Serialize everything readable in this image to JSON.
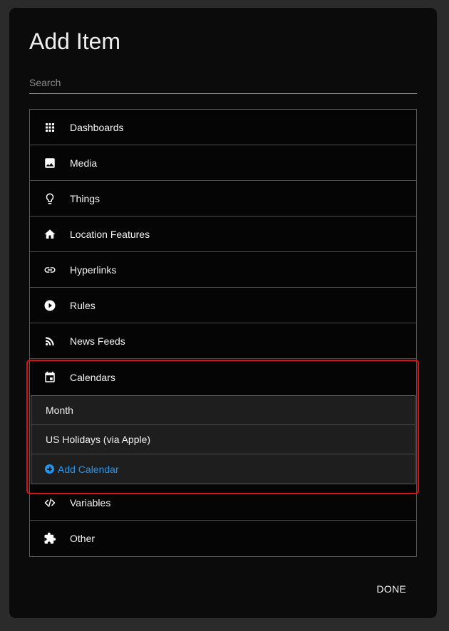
{
  "dialog": {
    "title": "Add Item",
    "search_placeholder": "Search",
    "done_label": "DONE"
  },
  "items": [
    {
      "label": "Dashboards",
      "icon": "grid-icon"
    },
    {
      "label": "Media",
      "icon": "image-icon"
    },
    {
      "label": "Things",
      "icon": "lightbulb-icon"
    },
    {
      "label": "Location Features",
      "icon": "home-icon"
    },
    {
      "label": "Hyperlinks",
      "icon": "link-icon"
    },
    {
      "label": "Rules",
      "icon": "play-circle-icon"
    },
    {
      "label": "News Feeds",
      "icon": "rss-icon"
    },
    {
      "label": "Calendars",
      "icon": "calendar-icon"
    },
    {
      "label": "Variables",
      "icon": "code-icon"
    },
    {
      "label": "Other",
      "icon": "puzzle-icon"
    }
  ],
  "calendars": {
    "entries": [
      "Month",
      "US Holidays (via Apple)"
    ],
    "add_label": "Add Calendar",
    "add_icon": "plus-circle-icon"
  },
  "colors": {
    "background": "#0b0b0b",
    "accent": "#2196f3",
    "highlight": "#e01010"
  }
}
